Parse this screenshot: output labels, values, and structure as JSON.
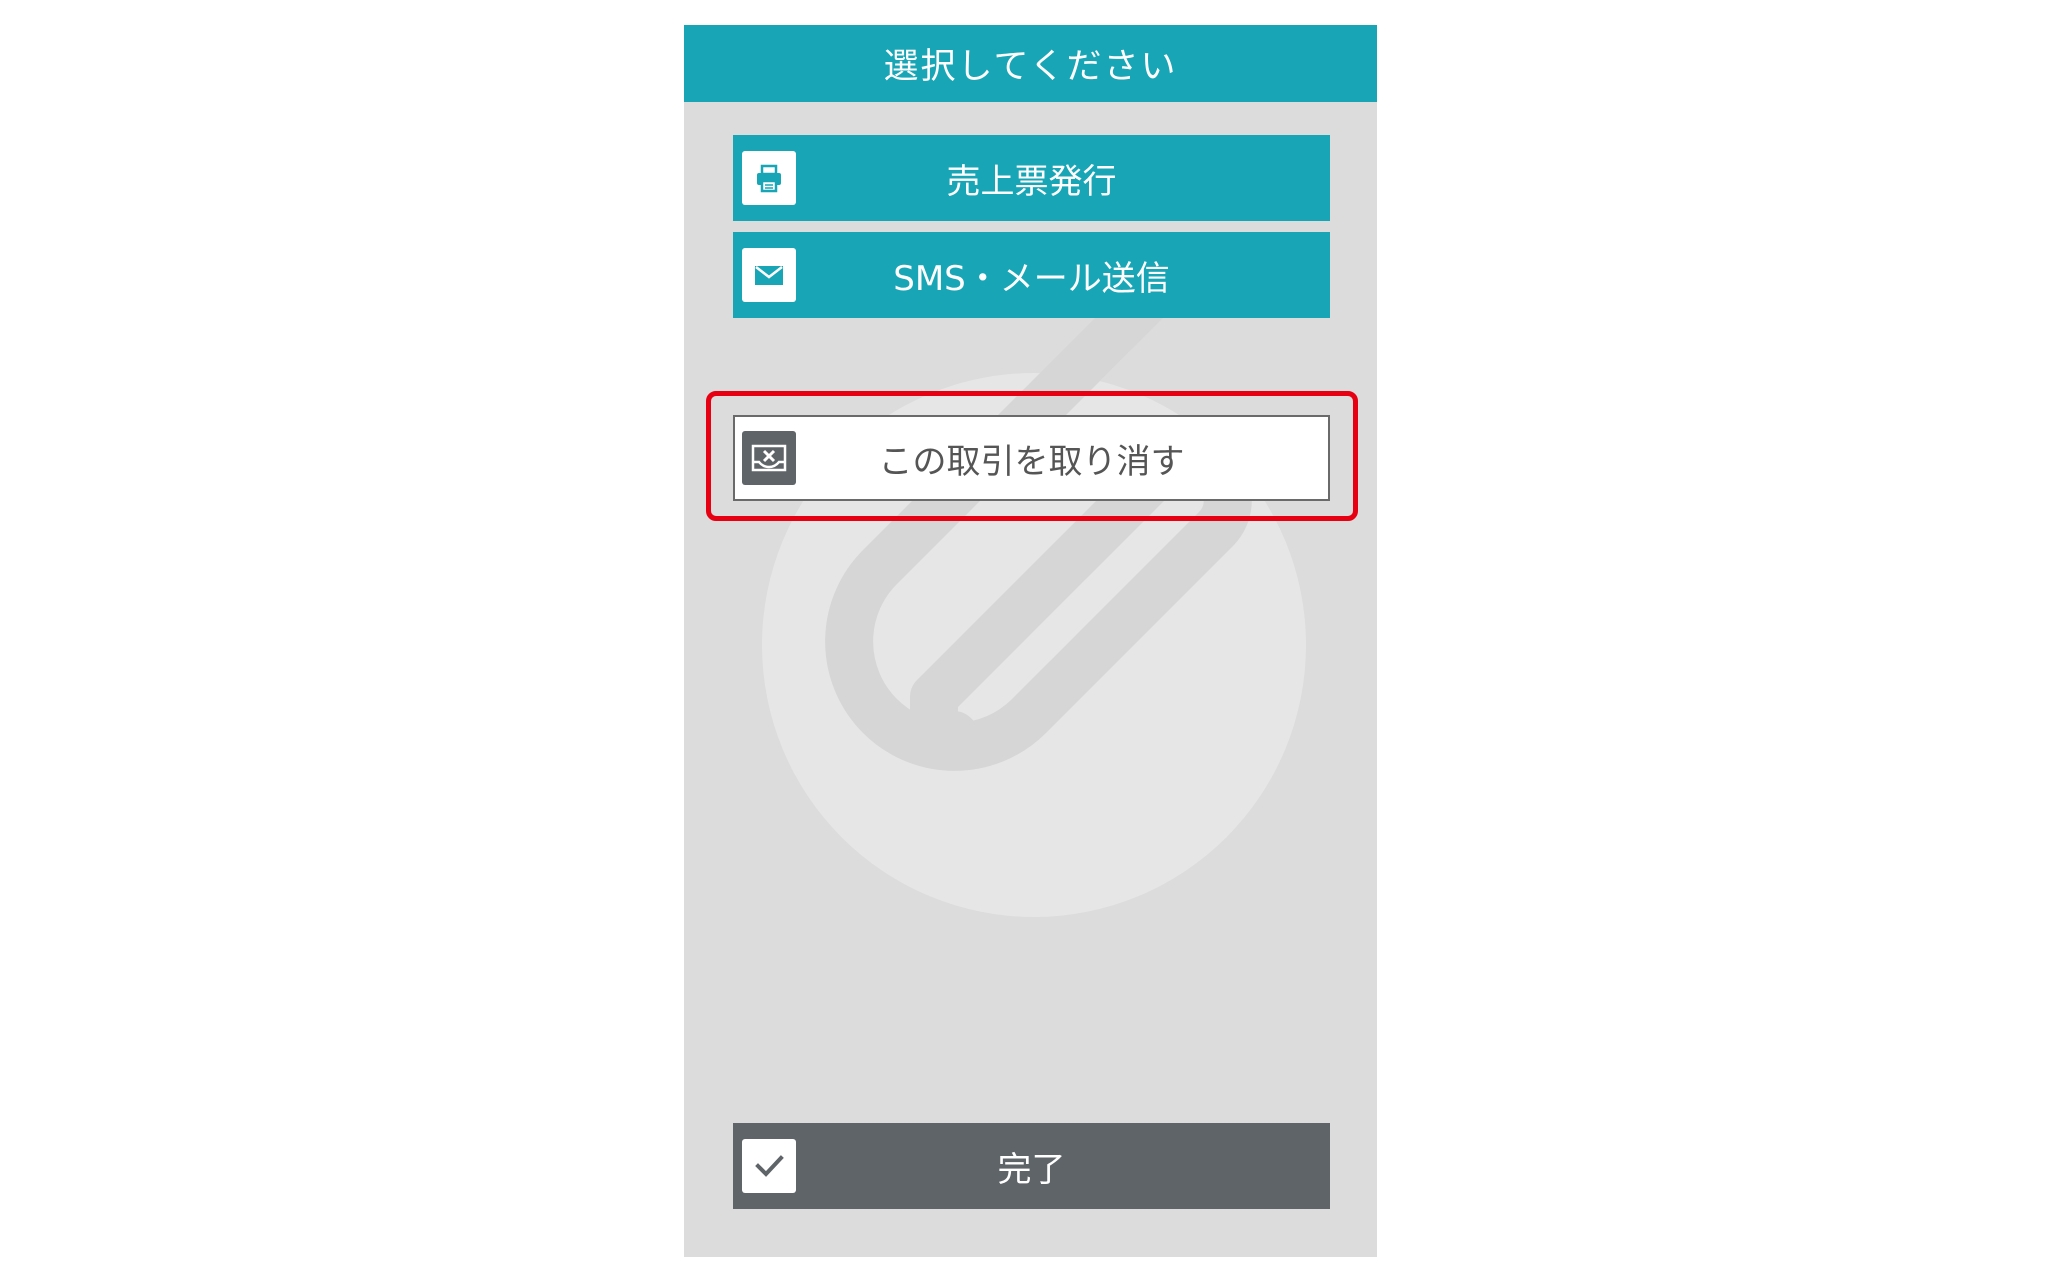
{
  "header": {
    "title": "選択してください"
  },
  "buttons": {
    "receipt_label": "売上票発行",
    "sms_mail_label": "SMS・メール送信",
    "cancel_label": "この取引を取り消す",
    "done_label": "完了"
  },
  "icons": {
    "receipt": "printer-icon",
    "sms_mail": "envelope-icon",
    "cancel": "cancel-transaction-icon",
    "done": "checkmark-icon",
    "watermark": "paperclip-logo"
  },
  "colors": {
    "accent": "#18a6b7",
    "dark_button": "#5e6467",
    "background": "#dcdcdc",
    "highlight": "#e60012"
  }
}
